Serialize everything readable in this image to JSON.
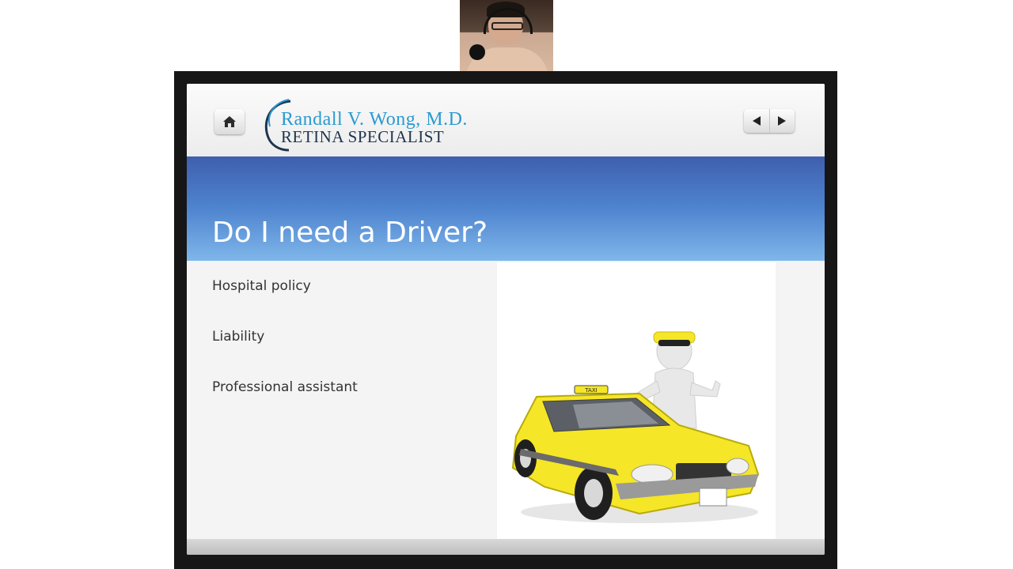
{
  "header": {
    "logo_line1": "Randall V. Wong, M.D.",
    "logo_line2": "Retina Specialist",
    "home_icon": "home-icon",
    "prev_icon": "triangle-left-icon",
    "next_icon": "triangle-right-icon"
  },
  "slide": {
    "title": "Do I need a Driver?",
    "bullets": [
      "Hospital policy",
      "Liability",
      "Professional assistant"
    ],
    "image_label": "TAXI"
  },
  "colors": {
    "title_band_top": "#3e5fae",
    "title_band_bottom": "#7fb7ea",
    "logo_blue": "#2a9ad0",
    "logo_navy": "#20364f",
    "taxi_yellow": "#f5e627"
  }
}
